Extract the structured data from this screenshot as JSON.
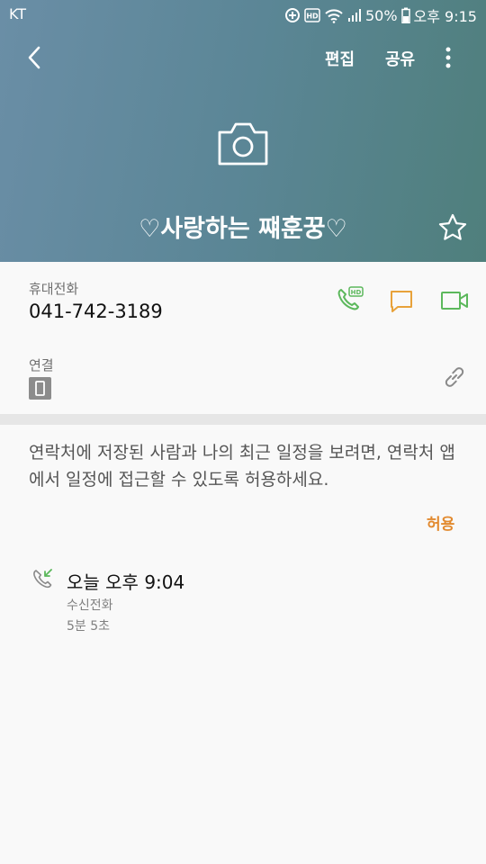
{
  "status_bar": {
    "carrier": "KT",
    "battery": "50%",
    "time": "오후 9:15"
  },
  "toolbar": {
    "edit_label": "편집",
    "share_label": "공유"
  },
  "contact": {
    "name": "♡사랑하는 쨰훈꿍♡"
  },
  "phone": {
    "label": "휴대전화",
    "number": "041-742-3189"
  },
  "connection": {
    "label": "연결"
  },
  "permission": {
    "message": "연락처에 저장된 사람과 나의 최근 일정을 보려면, 연락처 앱에서 일정에 접근할 수 있도록 허용하세요.",
    "allow_label": "허용"
  },
  "call_log": [
    {
      "time": "오늘 오후 9:04",
      "type": "수신전화",
      "duration": "5분 5초"
    }
  ],
  "icons": {
    "back": "back-arrow-icon",
    "more": "more-vert-icon",
    "camera": "camera-icon",
    "favorite": "star-icon",
    "hd_call": "hd-call-icon",
    "message": "message-icon",
    "video": "video-call-icon",
    "device": "phone-device-icon",
    "link": "link-icon",
    "incoming_call": "incoming-call-icon"
  },
  "colors": {
    "header_start": "#6a8ea6",
    "header_end": "#4f7f7c",
    "call_green": "#5cb85c",
    "message_orange": "#e8a23a",
    "allow_orange": "#e28a2f"
  }
}
